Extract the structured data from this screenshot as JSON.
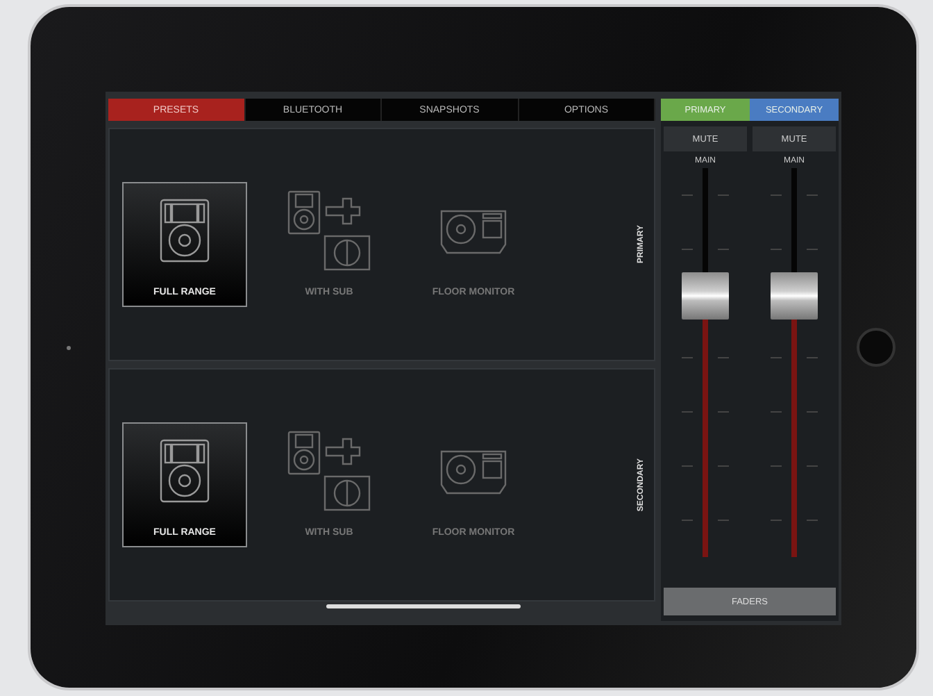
{
  "tabs": [
    {
      "label": "PRESETS",
      "selected": true
    },
    {
      "label": "BLUETOOTH",
      "selected": false
    },
    {
      "label": "SNAPSHOTS",
      "selected": false
    },
    {
      "label": "OPTIONS",
      "selected": false
    }
  ],
  "zones": [
    {
      "label": "PRIMARY",
      "presets": [
        {
          "kind": "full",
          "label": "FULL RANGE",
          "selected": true
        },
        {
          "kind": "sub",
          "label": "WITH SUB",
          "selected": false
        },
        {
          "kind": "monitor",
          "label": "FLOOR MONITOR",
          "selected": false
        }
      ]
    },
    {
      "label": "SECONDARY",
      "presets": [
        {
          "kind": "full",
          "label": "FULL RANGE",
          "selected": true
        },
        {
          "kind": "sub",
          "label": "WITH SUB",
          "selected": false
        },
        {
          "kind": "monitor",
          "label": "FLOOR MONITOR",
          "selected": false
        }
      ]
    }
  ],
  "mixer": {
    "channels": [
      {
        "name": "PRIMARY",
        "color": "#6aa84a",
        "mute": "MUTE",
        "fader_label": "MAIN",
        "level": 0.67
      },
      {
        "name": "SECONDARY",
        "color": "#4a7cc2",
        "mute": "MUTE",
        "fader_label": "MAIN",
        "level": 0.67
      }
    ],
    "mode_button": "FADERS"
  }
}
